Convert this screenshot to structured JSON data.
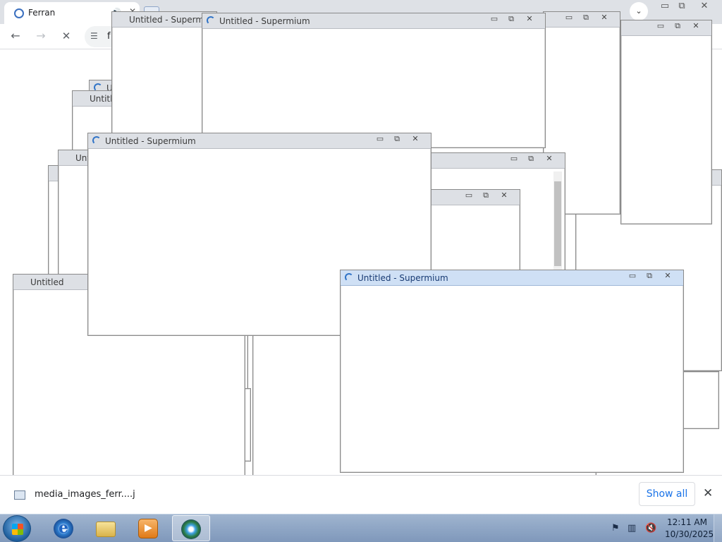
{
  "browser": {
    "tab_active_title": "Ferran",
    "tab_close_glyph": "✕",
    "tab_speaker_glyph": "🔊",
    "search_tabs_glyph": "⌄",
    "window_controls": {
      "minimize": "▭",
      "restore": "⧉",
      "close": "✕"
    },
    "nav": {
      "back": "←",
      "forward": "→",
      "stop": "✕"
    },
    "omnibox": {
      "value": "f",
      "site_info_icon": "tune-icon",
      "site_info_glyph": "☰"
    }
  },
  "popup": {
    "title": "Untitled - Supermium",
    "title_truncated_1": "Untitled - Supermiu",
    "title_truncated_2": "Untitled",
    "title_truncated_3": "Untitl",
    "title_truncated_4": "Unt",
    "title_truncated_5": "U",
    "minimize_glyph": "▭",
    "maximize_glyph": "⧉",
    "close_glyph": "✕"
  },
  "download_bar": {
    "file_name": "media_images_ferr....j",
    "show_all_label": "Show all",
    "close_glyph": "✕"
  },
  "taskbar": {
    "items": [
      "Internet Explorer",
      "Windows Explorer",
      "Windows Media Player",
      "Supermium"
    ],
    "clock_time": "12:11 AM",
    "clock_date": "10/30/2025",
    "tray_flag_glyph": "⚑",
    "tray_network_glyph": "▥",
    "tray_volume_glyph": "🔇"
  },
  "colors": {
    "taskbar": "#8ba3c4",
    "popup_titlebar": "#dde0e5",
    "popup_titlebar_active": "#cfe0f5",
    "link_blue": "#1a73e8"
  }
}
